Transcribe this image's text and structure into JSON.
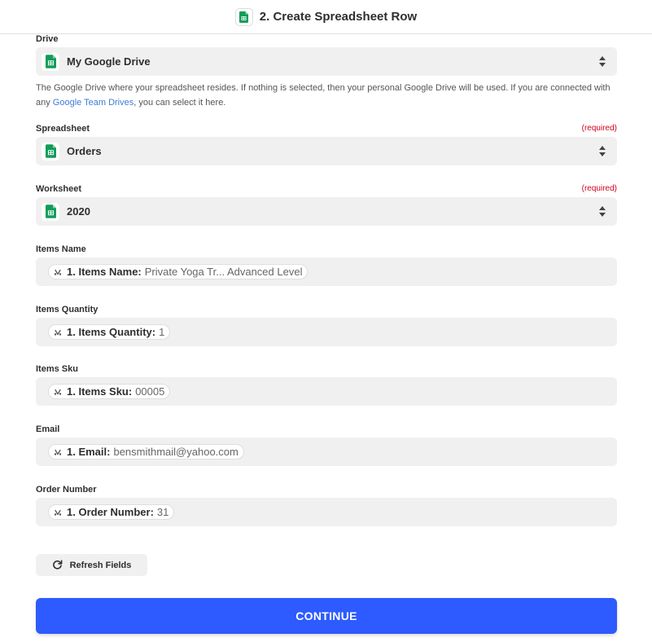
{
  "header": {
    "title": "2. Create Spreadsheet Row",
    "app_icon": "google-sheets-icon"
  },
  "drive": {
    "label": "Drive",
    "value": "My Google Drive",
    "help_before": "The Google Drive where your spreadsheet resides. If nothing is selected, then your personal Google Drive will be used. If you are connected with any ",
    "help_link": "Google Team Drives",
    "help_after": ", you can select it here."
  },
  "spreadsheet": {
    "label": "Spreadsheet",
    "required": "(required)",
    "value": "Orders"
  },
  "worksheet": {
    "label": "Worksheet",
    "required": "(required)",
    "value": "2020"
  },
  "mapped_fields": [
    {
      "label": "Items Name",
      "key": "1. Items Name:",
      "value": "Private Yoga Tr... Advanced Level"
    },
    {
      "label": "Items Quantity",
      "key": "1. Items Quantity:",
      "value": "1"
    },
    {
      "label": "Items Sku",
      "key": "1. Items Sku:",
      "value": "00005"
    },
    {
      "label": "Email",
      "key": "1. Email:",
      "value": "bensmithmail@yahoo.com"
    },
    {
      "label": "Order Number",
      "key": "1. Order Number:",
      "value": "31"
    }
  ],
  "buttons": {
    "refresh": "Refresh Fields",
    "continue": "CONTINUE"
  },
  "colors": {
    "accent": "#2e5bff",
    "sheets_green": "#0f9d58",
    "required": "#d0021b",
    "link": "#3d7bd9",
    "field_bg": "#f0f0f0"
  }
}
